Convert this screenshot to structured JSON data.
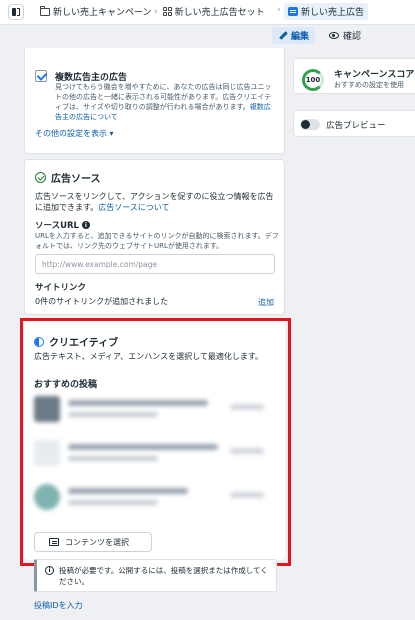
{
  "breadcrumb": {
    "campaign": "新しい売上キャンペーン",
    "adset": "新しい売上広告セット",
    "ad": "新しい売上広告"
  },
  "modes": {
    "edit": "編集",
    "review": "確認"
  },
  "multi_advertiser": {
    "title": "複数広告主の広告",
    "description": "見つけてもらう機会を増やすために、あなたの広告は同じ広告ユニットの他の広告と一緒に表示される可能性があります。広告クリエイティブは、サイズや切り取りの調整が行われる場合があります。",
    "link": "複数広告主の広告について",
    "more_settings": "その他の設定を表示 ▾"
  },
  "ad_source": {
    "title": "広告ソース",
    "description": "広告ソースをリンクして、アクションを促すのに役立つ情報を広告に追加できます。",
    "link": "広告ソースについて",
    "url_label": "ソースURL",
    "url_help": "URLを入力すると、追加できるサイトのリンクが自動的に検索されます。デフォルトでは、リンク先のウェブサイトURLが使用されます。",
    "url_placeholder": "http://www.example.com/page",
    "sitelinks_label": "サイトリンク",
    "sitelinks_status": "0件のサイトリンクが追加されました",
    "add": "追加"
  },
  "creative": {
    "title": "クリエイティブ",
    "description": "広告テキスト、メディア、エンハンスを選択して最適化します。",
    "recommended_posts": "おすすめの投稿",
    "posts": [
      {
        "thumb_color": "#6b7a86"
      },
      {
        "thumb_color": "#e9ecef"
      },
      {
        "thumb_color": "#7fb3b0"
      }
    ],
    "select_content": "コンテンツを選択"
  },
  "notice": {
    "text": "投稿が必要です。公開するには、投稿を選択または作成してください。"
  },
  "post_id_link": "投稿IDを入力",
  "campaign_score": {
    "value": "100",
    "title": "キャンペーンスコア",
    "subtitle": "おすすめの設定を使用"
  },
  "ad_preview": {
    "label": "広告プレビュー"
  },
  "colors": {
    "accent": "#1877f2",
    "highlight": "#e3151f",
    "score": "#31a24c"
  }
}
